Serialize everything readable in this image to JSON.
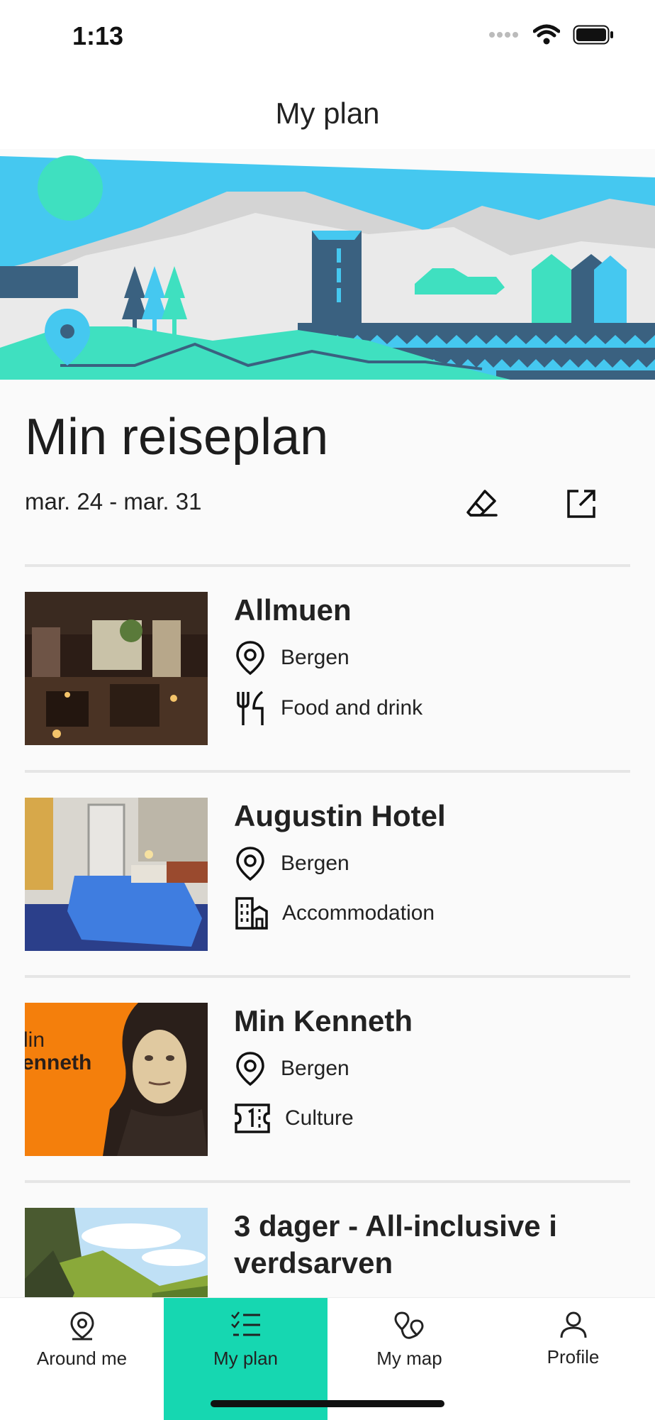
{
  "status": {
    "time": "1:13"
  },
  "nav": {
    "title": "My plan"
  },
  "plan": {
    "title": "Min reiseplan",
    "dates": "mar. 24 - mar. 31",
    "items": [
      {
        "name": "Allmuen",
        "location": "Bergen",
        "category": "Food and drink",
        "category_icon": "fork-knife-icon"
      },
      {
        "name": "Augustin Hotel",
        "location": "Bergen",
        "category": "Accommodation",
        "category_icon": "building-icon"
      },
      {
        "name": "Min Kenneth",
        "location": "Bergen",
        "category": "Culture",
        "category_icon": "ticket-icon",
        "thumb_text": "enneth",
        "thumb_text_top": "lin"
      },
      {
        "name": "3 dager - All-inclusive i verdsarven"
      }
    ]
  },
  "tabs": [
    {
      "label": "Around me",
      "icon": "location-pin-icon",
      "active": false
    },
    {
      "label": "My plan",
      "icon": "checklist-icon",
      "active": true
    },
    {
      "label": "My map",
      "icon": "map-pins-icon",
      "active": false
    },
    {
      "label": "Profile",
      "icon": "person-icon",
      "active": false
    }
  ],
  "colors": {
    "accent": "#16d7b1",
    "sky": "#45c8f0",
    "dark_blue": "#3a6180"
  }
}
